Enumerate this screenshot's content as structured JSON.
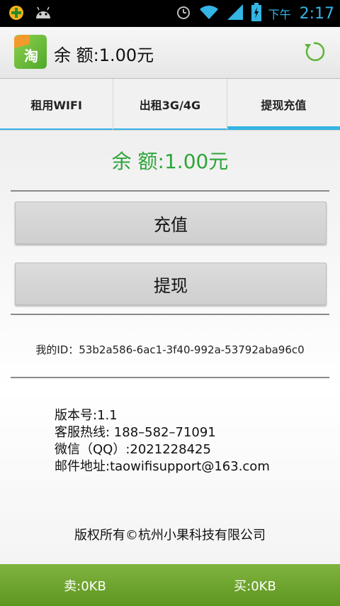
{
  "status_bar": {
    "ampm": "下午",
    "time": "2:17"
  },
  "action_bar": {
    "title": "余 额:1.00元",
    "app_icon_text": "淘"
  },
  "tabs": [
    {
      "label": "租用WIFI",
      "active": false
    },
    {
      "label": "出租3G/4G",
      "active": false
    },
    {
      "label": "提现充值",
      "active": true
    }
  ],
  "main": {
    "balance": "余 额:1.00元",
    "recharge_label": "充值",
    "withdraw_label": "提现",
    "my_id": "我的ID：53b2a586-6ac1-3f40-992a-53792aba96c0",
    "info_lines": [
      "版本号:1.1",
      "客服热线: 188–582–71091",
      "微信（QQ）:2021228425",
      "邮件地址:taowifisupport@163.com"
    ],
    "copyright": "版权所有©杭州小果科技有限公司"
  },
  "bottom_bar": {
    "sell": "卖:0KB",
    "buy": "买:0KB"
  },
  "colors": {
    "accent_blue": "#33b5e5",
    "balance_green": "#2ea53a",
    "bottom_bar_green": "#6aa52b"
  }
}
